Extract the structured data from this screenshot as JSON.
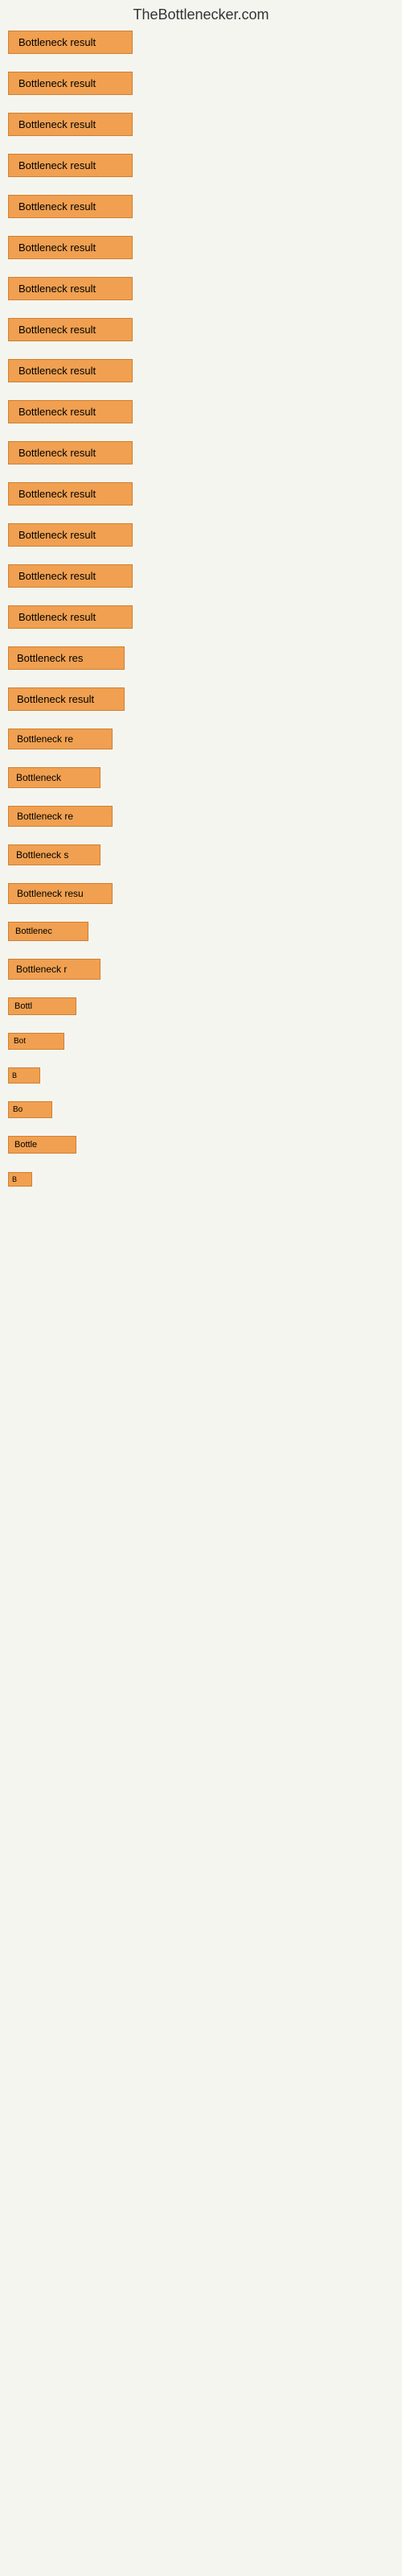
{
  "site": {
    "title": "TheBottlenecker.com"
  },
  "items": [
    {
      "label": "Bottleneck result",
      "size": "1",
      "margin_bottom": 22
    },
    {
      "label": "Bottleneck result",
      "size": "1",
      "margin_bottom": 22
    },
    {
      "label": "Bottleneck result",
      "size": "1",
      "margin_bottom": 22
    },
    {
      "label": "Bottleneck result",
      "size": "1",
      "margin_bottom": 22
    },
    {
      "label": "Bottleneck result",
      "size": "1",
      "margin_bottom": 22
    },
    {
      "label": "Bottleneck result",
      "size": "1",
      "margin_bottom": 22
    },
    {
      "label": "Bottleneck result",
      "size": "1",
      "margin_bottom": 22
    },
    {
      "label": "Bottleneck result",
      "size": "1",
      "margin_bottom": 22
    },
    {
      "label": "Bottleneck result",
      "size": "1",
      "margin_bottom": 22
    },
    {
      "label": "Bottleneck result",
      "size": "1",
      "margin_bottom": 22
    },
    {
      "label": "Bottleneck result",
      "size": "1",
      "margin_bottom": 22
    },
    {
      "label": "Bottleneck result",
      "size": "1",
      "margin_bottom": 22
    },
    {
      "label": "Bottleneck result",
      "size": "1",
      "margin_bottom": 22
    },
    {
      "label": "Bottleneck result",
      "size": "1",
      "margin_bottom": 22
    },
    {
      "label": "Bottleneck result",
      "size": "1",
      "margin_bottom": 22
    },
    {
      "label": "Bottleneck res",
      "size": "2",
      "margin_bottom": 22
    },
    {
      "label": "Bottleneck result",
      "size": "2",
      "margin_bottom": 22
    },
    {
      "label": "Bottleneck re",
      "size": "3",
      "margin_bottom": 22
    },
    {
      "label": "Bottleneck",
      "size": "4",
      "margin_bottom": 22
    },
    {
      "label": "Bottleneck re",
      "size": "3",
      "margin_bottom": 22
    },
    {
      "label": "Bottleneck s",
      "size": "4",
      "margin_bottom": 22
    },
    {
      "label": "Bottleneck resu",
      "size": "3",
      "margin_bottom": 22
    },
    {
      "label": "Bottlenec",
      "size": "5",
      "margin_bottom": 22
    },
    {
      "label": "Bottleneck r",
      "size": "4",
      "margin_bottom": 22
    },
    {
      "label": "Bottl",
      "size": "6",
      "margin_bottom": 22
    },
    {
      "label": "Bot",
      "size": "7",
      "margin_bottom": 22
    },
    {
      "label": "B",
      "size": "9",
      "margin_bottom": 22
    },
    {
      "label": "Bo",
      "size": "8",
      "margin_bottom": 22
    },
    {
      "label": "Bottle",
      "size": "6",
      "margin_bottom": 22
    },
    {
      "label": "B",
      "size": "10",
      "margin_bottom": 22
    }
  ]
}
